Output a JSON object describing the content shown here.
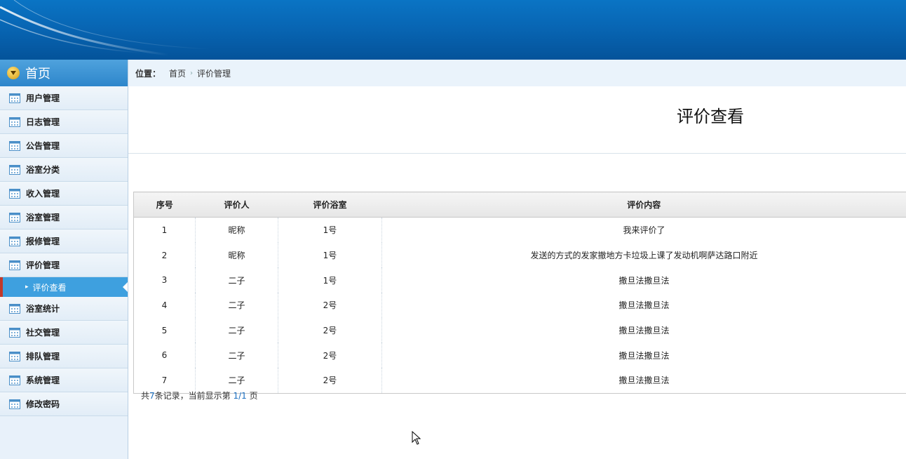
{
  "sidebar": {
    "home_label": "首页",
    "items": [
      {
        "label": "用户管理"
      },
      {
        "label": "日志管理"
      },
      {
        "label": "公告管理"
      },
      {
        "label": "浴室分类"
      },
      {
        "label": "收入管理"
      },
      {
        "label": "浴室管理"
      },
      {
        "label": "报修管理"
      },
      {
        "label": "评价管理"
      }
    ],
    "active_sub": "评价查看",
    "items_after": [
      {
        "label": "浴室统计"
      },
      {
        "label": "社交管理"
      },
      {
        "label": "排队管理"
      },
      {
        "label": "系统管理"
      },
      {
        "label": "修改密码"
      }
    ]
  },
  "breadcrumb": {
    "title": "位置：",
    "home": "首页",
    "current": "评价管理"
  },
  "page": {
    "title": "评价查看"
  },
  "table": {
    "headers": [
      "序号",
      "评价人",
      "评价浴室",
      "评价内容"
    ],
    "rows": [
      [
        "1",
        "昵称",
        "1号",
        "我来评价了"
      ],
      [
        "2",
        "昵称",
        "1号",
        "发送的方式的发家撤地方卡垃圾上课了发动机啊萨达路口附近"
      ],
      [
        "3",
        "二子",
        "1号",
        "撒旦法撒旦法"
      ],
      [
        "4",
        "二子",
        "2号",
        "撒旦法撒旦法"
      ],
      [
        "5",
        "二子",
        "2号",
        "撒旦法撒旦法"
      ],
      [
        "6",
        "二子",
        "2号",
        "撒旦法撒旦法"
      ],
      [
        "7",
        "二子",
        "2号",
        "撒旦法撒旦法"
      ]
    ]
  },
  "pager": {
    "prefix": "共",
    "total": "7",
    "middle": "条记录，当前显示第 ",
    "page": "1/1",
    "suffix": " 页"
  }
}
